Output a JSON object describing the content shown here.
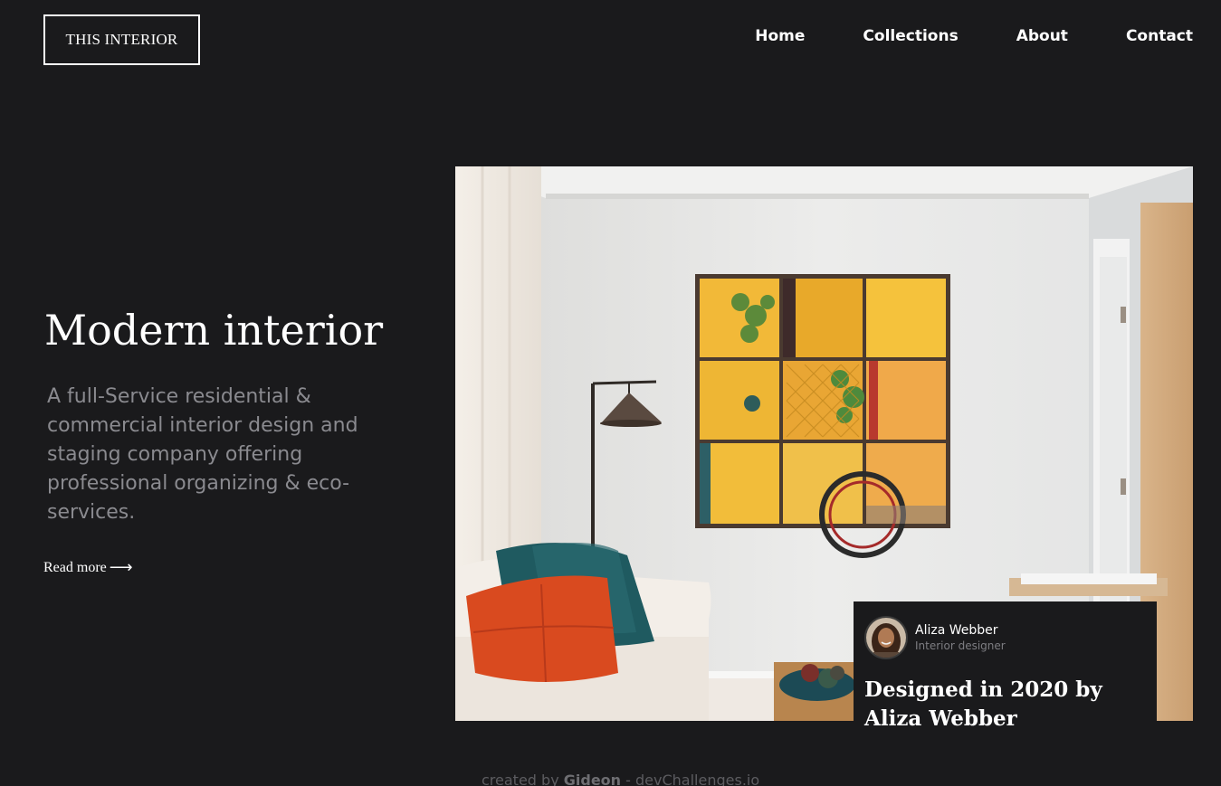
{
  "header": {
    "logo": "THIS INTERIOR",
    "nav": [
      "Home",
      "Collections",
      "About",
      "Contact"
    ]
  },
  "hero": {
    "title": "Modern interior",
    "description": "A full-Service residential & commercial interior design and staging company offering professional organizing & eco-services.",
    "read_more": "Read more",
    "read_more_icon": "arrow-right-icon"
  },
  "card": {
    "name": "Aliza Webber",
    "role": "Interior designer",
    "title": "Designed in 2020 by Aliza Webber"
  },
  "footer": {
    "prefix": "created by",
    "author": "Gideon",
    "suffix": "- devChallenges.io"
  },
  "colors": {
    "background": "#1a1a1c",
    "text": "#ffffff",
    "muted": "#8a8a8f"
  }
}
